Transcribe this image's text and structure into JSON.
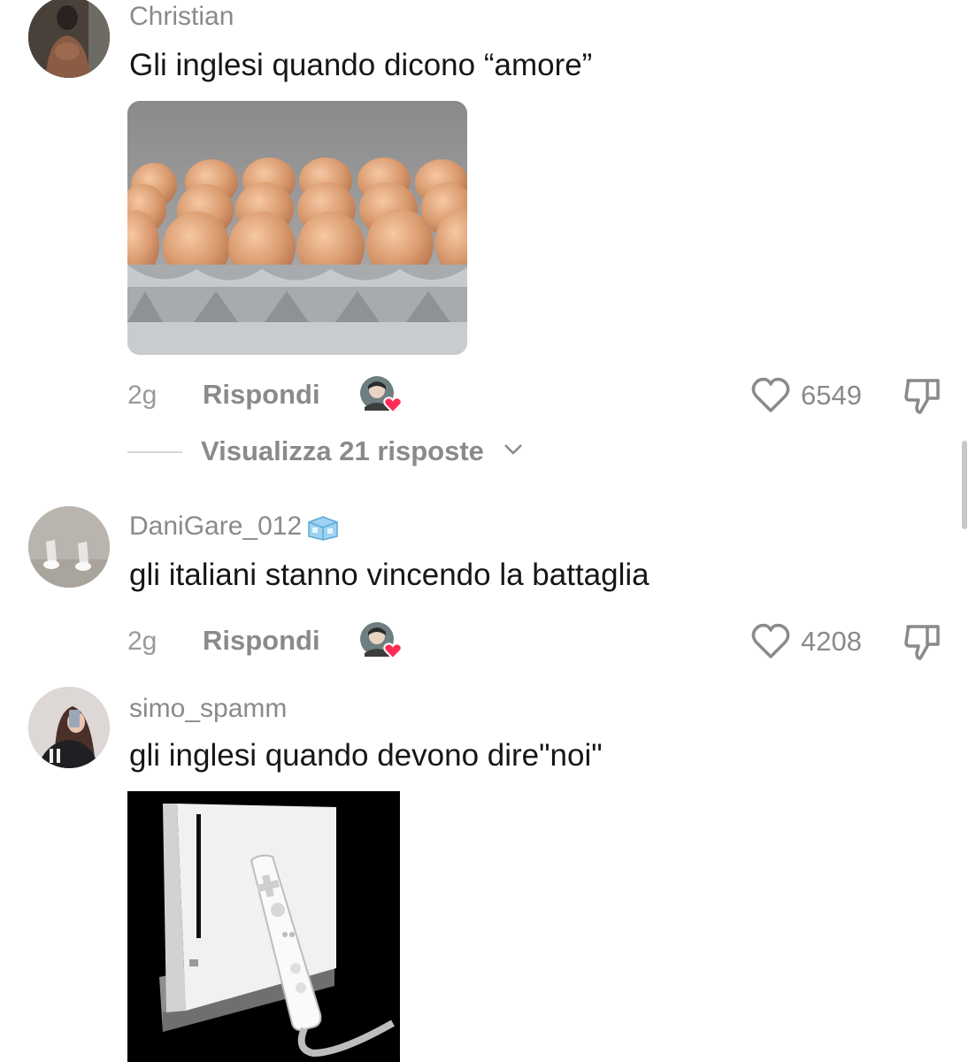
{
  "comments": [
    {
      "username": "Christian",
      "text": "Gli inglesi quando dicono “amore”",
      "image": "egg-tray-photo",
      "age": "2g",
      "reply_label": "Rispondi",
      "likes": "6549",
      "view_replies": "Visualizza 21 risposte"
    },
    {
      "username": "DaniGare_012",
      "badge": "ice-cube-emoji",
      "text": "gli italiani stanno vincendo la battaglia",
      "age": "2g",
      "reply_label": "Rispondi",
      "likes": "4208"
    },
    {
      "username": "simo_spamm",
      "text": "gli inglesi quando devono dire\"noi\"",
      "image": "wii-console-photo"
    }
  ],
  "icons": {
    "like": "heart-outline-icon",
    "dislike": "thumbs-down-icon",
    "creator_liked": "creator-heart-avatar-icon",
    "expand": "chevron-down-icon"
  },
  "colors": {
    "text": "#161616",
    "muted": "#8a8a8a",
    "heart_red": "#fe2c55"
  }
}
